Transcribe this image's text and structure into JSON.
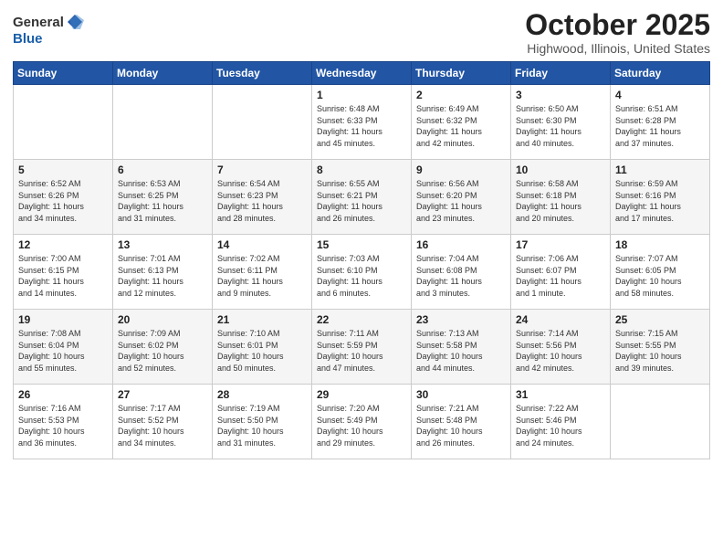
{
  "header": {
    "logo_general": "General",
    "logo_blue": "Blue",
    "month_title": "October 2025",
    "location": "Highwood, Illinois, United States"
  },
  "weekdays": [
    "Sunday",
    "Monday",
    "Tuesday",
    "Wednesday",
    "Thursday",
    "Friday",
    "Saturday"
  ],
  "weeks": [
    [
      {
        "day": "",
        "info": ""
      },
      {
        "day": "",
        "info": ""
      },
      {
        "day": "",
        "info": ""
      },
      {
        "day": "1",
        "info": "Sunrise: 6:48 AM\nSunset: 6:33 PM\nDaylight: 11 hours\nand 45 minutes."
      },
      {
        "day": "2",
        "info": "Sunrise: 6:49 AM\nSunset: 6:32 PM\nDaylight: 11 hours\nand 42 minutes."
      },
      {
        "day": "3",
        "info": "Sunrise: 6:50 AM\nSunset: 6:30 PM\nDaylight: 11 hours\nand 40 minutes."
      },
      {
        "day": "4",
        "info": "Sunrise: 6:51 AM\nSunset: 6:28 PM\nDaylight: 11 hours\nand 37 minutes."
      }
    ],
    [
      {
        "day": "5",
        "info": "Sunrise: 6:52 AM\nSunset: 6:26 PM\nDaylight: 11 hours\nand 34 minutes."
      },
      {
        "day": "6",
        "info": "Sunrise: 6:53 AM\nSunset: 6:25 PM\nDaylight: 11 hours\nand 31 minutes."
      },
      {
        "day": "7",
        "info": "Sunrise: 6:54 AM\nSunset: 6:23 PM\nDaylight: 11 hours\nand 28 minutes."
      },
      {
        "day": "8",
        "info": "Sunrise: 6:55 AM\nSunset: 6:21 PM\nDaylight: 11 hours\nand 26 minutes."
      },
      {
        "day": "9",
        "info": "Sunrise: 6:56 AM\nSunset: 6:20 PM\nDaylight: 11 hours\nand 23 minutes."
      },
      {
        "day": "10",
        "info": "Sunrise: 6:58 AM\nSunset: 6:18 PM\nDaylight: 11 hours\nand 20 minutes."
      },
      {
        "day": "11",
        "info": "Sunrise: 6:59 AM\nSunset: 6:16 PM\nDaylight: 11 hours\nand 17 minutes."
      }
    ],
    [
      {
        "day": "12",
        "info": "Sunrise: 7:00 AM\nSunset: 6:15 PM\nDaylight: 11 hours\nand 14 minutes."
      },
      {
        "day": "13",
        "info": "Sunrise: 7:01 AM\nSunset: 6:13 PM\nDaylight: 11 hours\nand 12 minutes."
      },
      {
        "day": "14",
        "info": "Sunrise: 7:02 AM\nSunset: 6:11 PM\nDaylight: 11 hours\nand 9 minutes."
      },
      {
        "day": "15",
        "info": "Sunrise: 7:03 AM\nSunset: 6:10 PM\nDaylight: 11 hours\nand 6 minutes."
      },
      {
        "day": "16",
        "info": "Sunrise: 7:04 AM\nSunset: 6:08 PM\nDaylight: 11 hours\nand 3 minutes."
      },
      {
        "day": "17",
        "info": "Sunrise: 7:06 AM\nSunset: 6:07 PM\nDaylight: 11 hours\nand 1 minute."
      },
      {
        "day": "18",
        "info": "Sunrise: 7:07 AM\nSunset: 6:05 PM\nDaylight: 10 hours\nand 58 minutes."
      }
    ],
    [
      {
        "day": "19",
        "info": "Sunrise: 7:08 AM\nSunset: 6:04 PM\nDaylight: 10 hours\nand 55 minutes."
      },
      {
        "day": "20",
        "info": "Sunrise: 7:09 AM\nSunset: 6:02 PM\nDaylight: 10 hours\nand 52 minutes."
      },
      {
        "day": "21",
        "info": "Sunrise: 7:10 AM\nSunset: 6:01 PM\nDaylight: 10 hours\nand 50 minutes."
      },
      {
        "day": "22",
        "info": "Sunrise: 7:11 AM\nSunset: 5:59 PM\nDaylight: 10 hours\nand 47 minutes."
      },
      {
        "day": "23",
        "info": "Sunrise: 7:13 AM\nSunset: 5:58 PM\nDaylight: 10 hours\nand 44 minutes."
      },
      {
        "day": "24",
        "info": "Sunrise: 7:14 AM\nSunset: 5:56 PM\nDaylight: 10 hours\nand 42 minutes."
      },
      {
        "day": "25",
        "info": "Sunrise: 7:15 AM\nSunset: 5:55 PM\nDaylight: 10 hours\nand 39 minutes."
      }
    ],
    [
      {
        "day": "26",
        "info": "Sunrise: 7:16 AM\nSunset: 5:53 PM\nDaylight: 10 hours\nand 36 minutes."
      },
      {
        "day": "27",
        "info": "Sunrise: 7:17 AM\nSunset: 5:52 PM\nDaylight: 10 hours\nand 34 minutes."
      },
      {
        "day": "28",
        "info": "Sunrise: 7:19 AM\nSunset: 5:50 PM\nDaylight: 10 hours\nand 31 minutes."
      },
      {
        "day": "29",
        "info": "Sunrise: 7:20 AM\nSunset: 5:49 PM\nDaylight: 10 hours\nand 29 minutes."
      },
      {
        "day": "30",
        "info": "Sunrise: 7:21 AM\nSunset: 5:48 PM\nDaylight: 10 hours\nand 26 minutes."
      },
      {
        "day": "31",
        "info": "Sunrise: 7:22 AM\nSunset: 5:46 PM\nDaylight: 10 hours\nand 24 minutes."
      },
      {
        "day": "",
        "info": ""
      }
    ]
  ]
}
